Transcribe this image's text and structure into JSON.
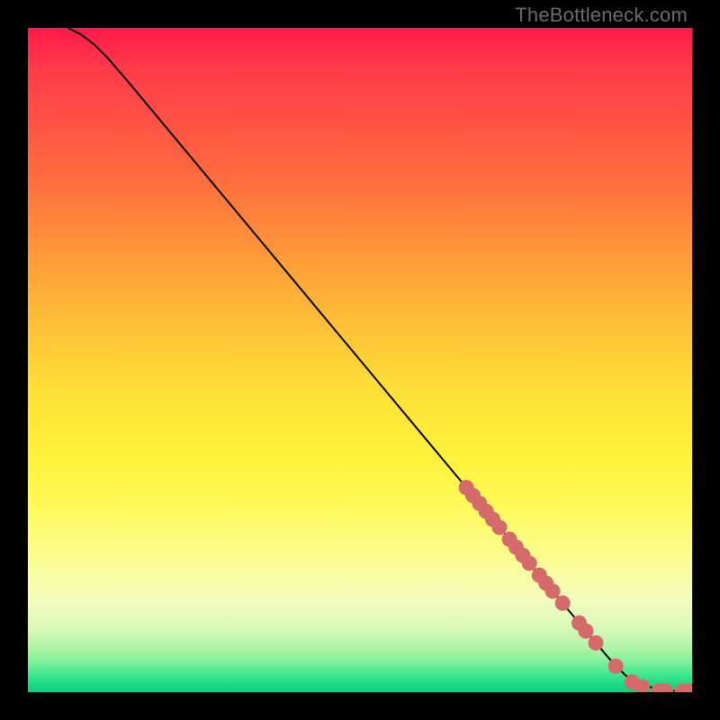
{
  "attribution": "TheBottleneck.com",
  "colors": {
    "marker": "#d46a6a",
    "marker_stroke": "#b85252",
    "line": "#000000"
  },
  "chart_data": {
    "type": "line",
    "title": "",
    "xlabel": "",
    "ylabel": "",
    "xlim": [
      0,
      100
    ],
    "ylim": [
      0,
      100
    ],
    "grid": false,
    "legend": false,
    "series": [
      {
        "name": "curve",
        "x": [
          6,
          8,
          10,
          12,
          15,
          20,
          30,
          40,
          50,
          60,
          70,
          80,
          85,
          88,
          90,
          92,
          95,
          98,
          100
        ],
        "y": [
          100,
          99,
          97.5,
          95.5,
          92,
          86,
          74,
          62,
          50,
          38,
          26,
          14,
          8,
          4.5,
          2.5,
          1.2,
          0.4,
          0.1,
          0.1
        ]
      }
    ],
    "markers": {
      "name": "highlighted-points",
      "x": [
        66,
        67,
        68,
        69,
        70,
        71,
        72.5,
        73.5,
        74.5,
        75.5,
        77,
        78,
        79,
        80.5,
        83,
        84,
        85.5,
        88.5,
        91,
        92.5,
        95,
        96,
        98.5,
        99.5
      ],
      "y": [
        30.8,
        29.6,
        28.4,
        27.2,
        26.0,
        24.8,
        23.0,
        21.8,
        20.6,
        19.4,
        17.6,
        16.4,
        15.2,
        13.4,
        10.4,
        9.2,
        7.4,
        3.9,
        1.5,
        0.8,
        0.2,
        0.15,
        0.1,
        0.1
      ]
    }
  }
}
